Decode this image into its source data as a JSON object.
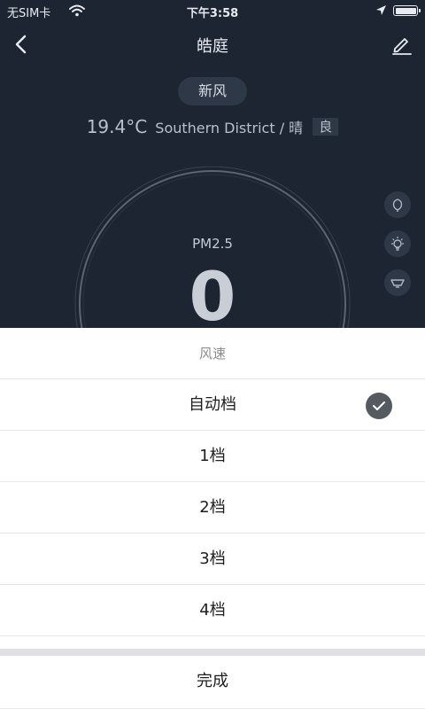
{
  "status_bar": {
    "carrier": "无SIM卡",
    "time": "下午3:58"
  },
  "nav": {
    "title": "皓庭",
    "back_icon": "chevron-left-icon",
    "edit_icon": "pencil-icon"
  },
  "device": {
    "mode": "新风",
    "temperature": "19.4°C",
    "location_weather": "Southern District / 晴",
    "air_quality": "良",
    "metric_label": "PM2.5",
    "metric_value": "0"
  },
  "side_buttons": [
    "leaf-icon",
    "bulb-icon",
    "fan-icon"
  ],
  "sheet": {
    "title": "风速",
    "options": [
      {
        "label": "自动档",
        "selected": true
      },
      {
        "label": "1档",
        "selected": false
      },
      {
        "label": "2档",
        "selected": false
      },
      {
        "label": "3档",
        "selected": false
      },
      {
        "label": "4档",
        "selected": false
      }
    ],
    "done_label": "完成"
  },
  "colors": {
    "background": "#1d2533",
    "pill": "#2f3847",
    "check": "#555a61"
  }
}
